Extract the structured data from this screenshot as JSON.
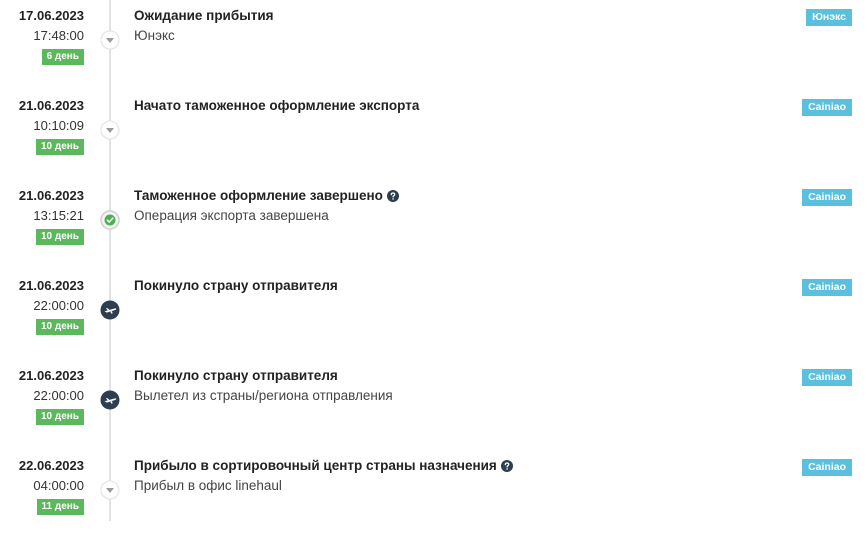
{
  "events": [
    {
      "date": "17.06.2023",
      "time": "17:48:00",
      "days": "6 день",
      "title": "Ожидание прибытия",
      "subtitle": "Юнэкс",
      "carrier": "Юнэкс",
      "icon": "chevron-down-icon",
      "has_help": false
    },
    {
      "date": "21.06.2023",
      "time": "10:10:09",
      "days": "10 день",
      "title": "Начато таможенное оформление экспорта",
      "subtitle": "",
      "carrier": "Cainiao",
      "icon": "chevron-down-icon",
      "has_help": false
    },
    {
      "date": "21.06.2023",
      "time": "13:15:21",
      "days": "10 день",
      "title": "Таможенное оформление завершено",
      "subtitle": "Операция экспорта завершена",
      "carrier": "Cainiao",
      "icon": "check-icon",
      "has_help": true
    },
    {
      "date": "21.06.2023",
      "time": "22:00:00",
      "days": "10 день",
      "title": "Покинуло страну отправителя",
      "subtitle": "",
      "carrier": "Cainiao",
      "icon": "airplane-icon",
      "has_help": false
    },
    {
      "date": "21.06.2023",
      "time": "22:00:00",
      "days": "10 день",
      "title": "Покинуло страну отправителя",
      "subtitle": "Вылетел из страны/региона отправления",
      "carrier": "Cainiao",
      "icon": "airplane-icon",
      "has_help": false
    },
    {
      "date": "22.06.2023",
      "time": "04:00:00",
      "days": "11 день",
      "title": "Прибыло в сортировочный центр страны назначения",
      "subtitle": "Прибыл в офис linehaul",
      "carrier": "Cainiao",
      "icon": "chevron-down-icon",
      "has_help": true
    }
  ],
  "colors": {
    "days_badge": "#5cb85c",
    "carrier_badge": "#5bc0de",
    "check_icon": "#4caf50",
    "plane_circle": "#2c3e50",
    "help_icon": "#2c3e50"
  }
}
